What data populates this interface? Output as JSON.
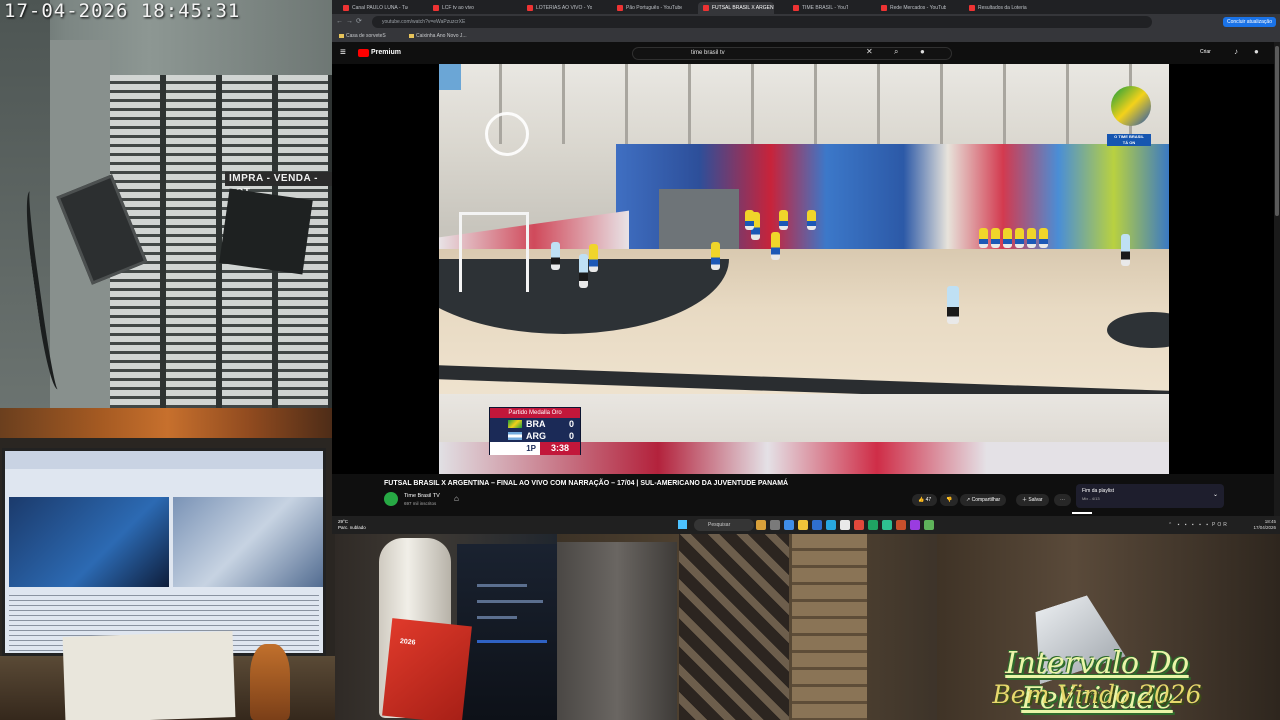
{
  "overlay": {
    "timestamp": "17-04-2026  18:45:31",
    "store_sign": "IMPRA - VENDA - LOT",
    "title_line1": "Intervalo Do Felicidade",
    "title_line2": "Bem Vindo 2026",
    "box_text": "2026"
  },
  "browser": {
    "tabs": [
      {
        "label": "Canal PAULO LUNA - Tudo ao vivo"
      },
      {
        "label": "LCF tv ao vivo"
      },
      {
        "label": "LOTERIAS AO VIVO - YouTube"
      },
      {
        "label": "Pão Português - YouTube"
      },
      {
        "label": "FUTSAL BRASIL X ARGENTINA",
        "active": true
      },
      {
        "label": "TIME BRASIL - YouTube"
      },
      {
        "label": "Rede Mercados - YouTube"
      },
      {
        "label": "Resultados da Loteria"
      }
    ],
    "url": "youtube.com/watch?v=eWaPzuzcrXE",
    "extension_button": "Concluir atualização",
    "bookmarks": [
      "Casa de sorveteS",
      "Caixinha Ano Novo J..."
    ]
  },
  "youtube": {
    "logo_text": "Premium",
    "search_query": "time brasil tv",
    "create_label": "Criar",
    "video": {
      "title": "FUTSAL BRASIL X ARGENTINA – FINAL AO VIVO COM NARRAÇÃO – 17/04 | SUL-AMERICANO DA JUVENTUDE PANAMÁ",
      "channel": "Time Brasil TV",
      "subscribers": "697 mil inscritos",
      "likes": "47",
      "share": "Compartilhar",
      "save": "Salvar",
      "more": "⋯",
      "watermark_badge": "O TIME BRASIL",
      "watermark_sub": "TÁ ON",
      "scorebug": {
        "header": "Partido Medalla Oro",
        "team1": "BRA",
        "score1": "0",
        "team2": "ARG",
        "score2": "0",
        "period": "1P",
        "clock": "3:38"
      }
    },
    "playlist": {
      "title": "Fim da playlist",
      "subtitle": "Mix - 4/13"
    }
  },
  "taskbar": {
    "weather_temp": "29°C",
    "weather_desc": "Parc. nublado",
    "search_label": "Pesquisar",
    "time": "18:45",
    "date": "17/04/2026",
    "lang": "POR"
  },
  "icons": [
    "menu-icon",
    "youtube-logo-icon",
    "search-icon",
    "mic-icon",
    "close-icon",
    "bell-icon",
    "like-icon",
    "dislike-icon",
    "share-icon",
    "save-icon",
    "windows-icon"
  ]
}
